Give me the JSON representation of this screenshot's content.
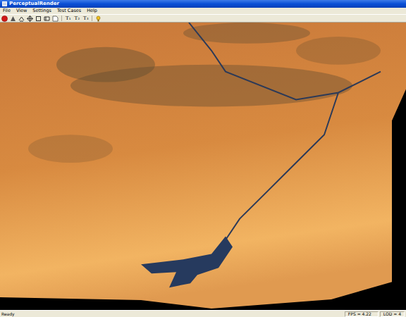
{
  "window": {
    "title": "PerceptualRender"
  },
  "menu": [
    "File",
    "View",
    "Settings",
    "Test Cases",
    "Help"
  ],
  "toolbar": {
    "text_buttons": [
      "T₁",
      "T₂",
      "T₃"
    ]
  },
  "viewport": {
    "content": "terrain render"
  },
  "status_bar": {
    "message": "Ready",
    "panels": [
      "FPS = 4.22",
      "LOD = 4"
    ]
  }
}
